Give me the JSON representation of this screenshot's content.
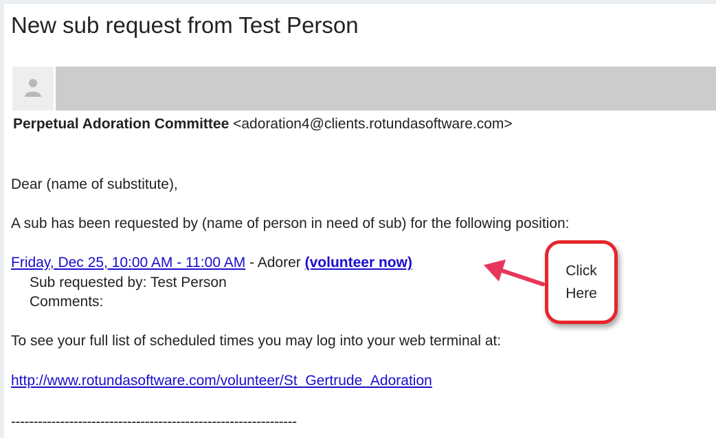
{
  "email": {
    "subject": "New sub request from Test Person",
    "sender_name": "Perpetual Adoration Committee",
    "sender_email": "<adoration4@clients.rotundasoftware.com>",
    "greeting": "Dear (name of substitute),",
    "intro": "A sub has been requested by (name of person in need of sub) for the following position:",
    "position_link": "Friday, Dec 25, 10:00 AM - 11:00 AM",
    "position_role": " - Adorer ",
    "volunteer_link": "(volunteer now)",
    "requested_by": "Sub requested by: Test Person",
    "comments": "Comments:",
    "login_text": "To see your full list of scheduled times you may log into your web terminal at:",
    "terminal_url": "http://www.rotundasoftware.com/volunteer/St_Gertrude_Adoration",
    "divider": "----------------------------------------------------------------"
  },
  "callout": {
    "line1": "Click",
    "line2": "Here"
  },
  "colors": {
    "link": "#1a0dcc",
    "callout_border": "#e4262a",
    "arrow": "#e8365a",
    "sender_bar": "#cccccc"
  },
  "icons": {
    "avatar": "person-icon"
  }
}
